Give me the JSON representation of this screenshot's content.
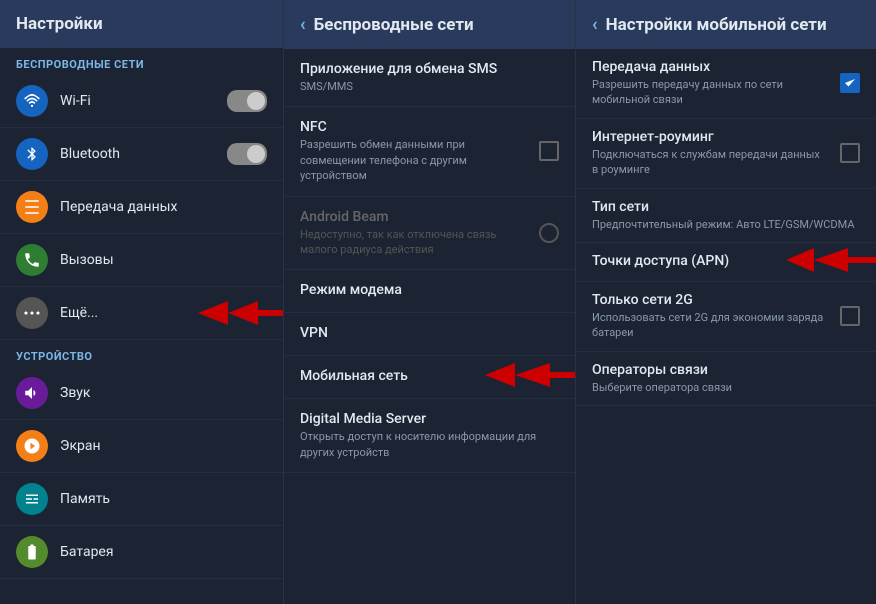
{
  "panels": {
    "left": {
      "title": "Настройки",
      "sections": [
        {
          "label": "БЕСПРОВОДНЫЕ СЕТИ",
          "items": [
            {
              "id": "wifi",
              "icon": "wifi",
              "label": "Wi-Fi",
              "hasToggle": true,
              "iconSymbol": "📶"
            },
            {
              "id": "bluetooth",
              "icon": "bluetooth",
              "label": "Bluetooth",
              "hasToggle": true,
              "iconSymbol": "⬡"
            },
            {
              "id": "data",
              "icon": "data",
              "label": "Передача данных",
              "hasToggle": false,
              "iconSymbol": "📊"
            },
            {
              "id": "calls",
              "icon": "calls",
              "label": "Вызовы",
              "hasToggle": false,
              "iconSymbol": "📞"
            },
            {
              "id": "more",
              "icon": "more",
              "label": "Ещё...",
              "hasToggle": false,
              "hasArrow": true,
              "iconSymbol": "⋯"
            }
          ]
        },
        {
          "label": "УСТРОЙСТВО",
          "items": [
            {
              "id": "sound",
              "icon": "sound",
              "label": "Звук",
              "hasToggle": false,
              "iconSymbol": "🔊"
            },
            {
              "id": "display",
              "icon": "display",
              "label": "Экран",
              "hasToggle": false,
              "iconSymbol": "💡"
            },
            {
              "id": "storage",
              "icon": "storage",
              "label": "Память",
              "hasToggle": false,
              "iconSymbol": "💾"
            },
            {
              "id": "battery",
              "icon": "battery",
              "label": "Батарея",
              "hasToggle": false,
              "iconSymbol": "🔋"
            }
          ]
        }
      ]
    },
    "middle": {
      "title": "Беспроводные сети",
      "items": [
        {
          "id": "sms",
          "title": "Приложение для обмена SMS",
          "subtitle": "SMS/MMS",
          "hasCheckbox": false,
          "disabled": false,
          "hasArrow": false
        },
        {
          "id": "nfc",
          "title": "NFC",
          "subtitle": "Разрешить обмен данными при совмещении телефона с другим устройством",
          "hasCheckbox": true,
          "checked": false,
          "disabled": false,
          "hasArrow": false
        },
        {
          "id": "android-beam",
          "title": "Android Beam",
          "subtitle": "Недоступно, так как отключена связь малого радиуса действия",
          "hasCheckbox": false,
          "disabled": true,
          "hasArrow": false
        },
        {
          "id": "modem",
          "title": "Режим модема",
          "subtitle": "",
          "hasCheckbox": false,
          "disabled": false,
          "hasArrow": false
        },
        {
          "id": "vpn",
          "title": "VPN",
          "subtitle": "",
          "hasCheckbox": false,
          "disabled": false,
          "hasArrow": false
        },
        {
          "id": "mobile",
          "title": "Мобильная сеть",
          "subtitle": "",
          "hasCheckbox": false,
          "disabled": false,
          "hasArrow": true
        },
        {
          "id": "media-server",
          "title": "Digital Media Server",
          "subtitle": "Открыть доступ к носителю информации для других устройств",
          "hasCheckbox": false,
          "disabled": false,
          "hasArrow": false
        }
      ]
    },
    "right": {
      "title": "Настройки мобильной сети",
      "items": [
        {
          "id": "data-transfer",
          "title": "Передача данных",
          "subtitle": "Разрешить передачу данных по сети мобильной связи",
          "hasCheckbox": true,
          "checked": true
        },
        {
          "id": "roaming",
          "title": "Интернет-роуминг",
          "subtitle": "Подключаться к службам передачи данных в роуминге",
          "hasCheckbox": true,
          "checked": false
        },
        {
          "id": "network-type",
          "title": "Тип сети",
          "subtitle": "Предпочтительный режим: Авто LTE/GSM/WCDMA",
          "hasCheckbox": false,
          "checked": false
        },
        {
          "id": "apn",
          "title": "Точки доступа (APN)",
          "subtitle": "",
          "hasCheckbox": false,
          "checked": false,
          "hasArrow": true
        },
        {
          "id": "2g-only",
          "title": "Только сети 2G",
          "subtitle": "Использовать сети 2G для экономии заряда батареи",
          "hasCheckbox": true,
          "checked": false
        },
        {
          "id": "operators",
          "title": "Операторы связи",
          "subtitle": "Выберите оператора связи",
          "hasCheckbox": false,
          "checked": false
        }
      ]
    }
  }
}
